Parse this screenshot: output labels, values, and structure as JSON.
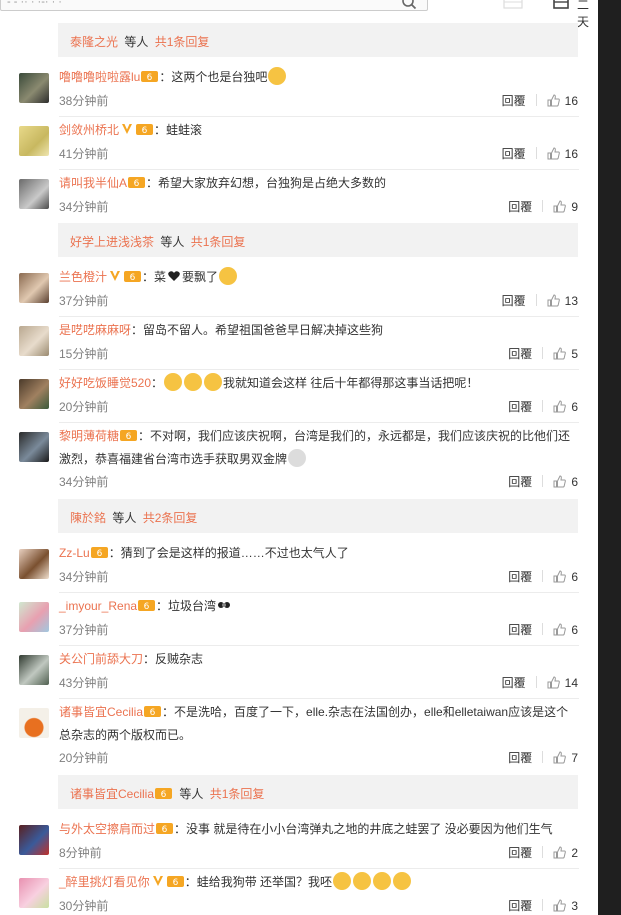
{
  "header": {
    "search_text": "- - ·· · ·-· · ·",
    "right_label": "二天"
  },
  "colors": {
    "accent": "#eb7350",
    "text": "#333333",
    "muted": "#808080",
    "bar_bg": "#f2f2f2",
    "like_icon": "#999999"
  },
  "reply_bars": [
    {
      "user": "泰隆之光",
      "mid": "等人",
      "count": "共1条回复"
    },
    {
      "user": "好学上进浅浅茶",
      "mid": "等人",
      "count": "共1条回复"
    },
    {
      "user": "陳於銘",
      "mid": "等人",
      "count": "共2条回复"
    },
    {
      "user": "诸事皆宜Cecilia",
      "mid": "等人",
      "count": "共1条回复"
    }
  ],
  "comments": [
    {
      "user": "噜噜噜啦啦露lu",
      "text": "：这两个也是台独吧",
      "time": "38分钟前",
      "reply": "回覆",
      "likes": "16"
    },
    {
      "user": "剑敛州桥北",
      "text": "：蛙蛙滚",
      "time": "41分钟前",
      "reply": "回覆",
      "likes": "16"
    },
    {
      "user": "请叫我半仙A",
      "text": "：希望大家放弃幻想，台独狗是占绝大多数的",
      "time": "34分钟前",
      "reply": "回覆",
      "likes": "9"
    },
    {
      "user": "兰色橙汁",
      "text": "：菜",
      "text2": "要飘了",
      "time": "37分钟前",
      "reply": "回覆",
      "likes": "13"
    },
    {
      "user": "是呓呓麻麻呀",
      "text": "：留岛不留人。希望祖国爸爸早日解决掉这些狗",
      "time": "15分钟前",
      "reply": "回覆",
      "likes": "5"
    },
    {
      "user": "好好吃饭睡觉520",
      "text": "：",
      "text2": "我就知道会这样 往后十年都得那这事当话把呢！",
      "time": "20分钟前",
      "reply": "回覆",
      "likes": "6"
    },
    {
      "user": "黎明薄荷糖",
      "text": "：不对啊，我们应该庆祝啊，台湾是我们的，永远都是，我们应该庆祝的比他们还",
      "text2": "激烈，恭喜福建省台湾市选手获取男双金牌",
      "time": "34分钟前",
      "reply": "回覆",
      "likes": "6"
    },
    {
      "user": "Zz-Lu",
      "text": "：猜到了会是这样的报道……不过也太气人了",
      "time": "34分钟前",
      "reply": "回覆",
      "likes": "6"
    },
    {
      "user": "_imyour_Rena",
      "text": "：垃圾台湾",
      "time": "37分钟前",
      "reply": "回覆",
      "likes": "6"
    },
    {
      "user": "关公门前舔大刀",
      "text": "：反贼杂志",
      "time": "43分钟前",
      "reply": "回覆",
      "likes": "14"
    },
    {
      "user": "诸事皆宜Cecilia",
      "text": "：不是洗哈，百度了一下，elle.杂志在法国创办，elle和elletaiwan应该是这个",
      "text2": "总杂志的两个版权而已。",
      "time": "20分钟前",
      "reply": "回覆",
      "likes": "7"
    },
    {
      "user": "与外太空擦肩而过",
      "text": "：没事 就是待在小小台湾弹丸之地的井底之蛙罢了  没必要因为他们生气",
      "time": "8分钟前",
      "reply": "回覆",
      "likes": "2"
    },
    {
      "user": "_醉里挑灯看见你",
      "text": "：蛙给我狗带 还举国？我呸",
      "time": "30分钟前",
      "reply": "回覆",
      "likes": "3"
    }
  ]
}
